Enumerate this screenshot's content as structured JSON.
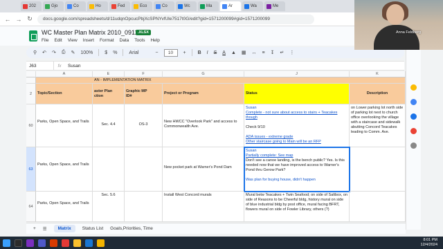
{
  "browser": {
    "tabs": [
      "202",
      "Gjo",
      "Co",
      "Ho",
      "Fed",
      "Eco",
      "Co",
      "Wc",
      "Ma",
      "Ar",
      "Wa",
      "Me"
    ],
    "url": "docs.google.com/spreadsheets/d/11udqnOpcucPbjXcSPNYvfUle7517t0G/edit?gid=1571200099#gid=1571200099"
  },
  "webcam": {
    "name": "Anna Feldberg"
  },
  "doc": {
    "title": "WC Master Plan Matrix 2010_091124",
    "badge": ".XLSX",
    "menus": [
      "File",
      "Edit",
      "View",
      "Insert",
      "Format",
      "Data",
      "Tools",
      "Help"
    ]
  },
  "toolbar": {
    "zoom": "100%",
    "font": "Arial",
    "font_size": "10"
  },
  "formula_bar": {
    "cell_ref": "J63",
    "fx": "fx",
    "value": "Susan"
  },
  "grid": {
    "columns": [
      "A",
      "E",
      "F",
      "G",
      "H",
      "J",
      "K"
    ],
    "banner": "AN - IMPLEMENTATION MATRIX",
    "header_row_num": "2",
    "headers": {
      "topic": "Topic/Section",
      "master_plan": "aster Plan\nction",
      "graphic": "Graphic MP\nID#",
      "project": "Project or Program",
      "status": "Status",
      "description": "Description"
    },
    "rows": [
      {
        "num": "60",
        "topic": "Parks, Open Space, and Trails",
        "section": "Sec. 4.4",
        "graphic": "OS-3",
        "project": "New HWCC \"Overlook Park\" and access to Commonwealth Ave.",
        "status_lines": [
          {
            "text": "Susan",
            "style": "blue"
          },
          {
            "text": "Complete - not sure about access to stairs + Teacakes though",
            "style": "link"
          },
          {
            "text": "",
            "style": ""
          },
          {
            "text": "Check 9/10",
            "style": ""
          },
          {
            "text": "",
            "style": ""
          },
          {
            "text": "ADA issues - extreme grade",
            "style": "link"
          },
          {
            "text": "Other staircase going to Main will be an RFP",
            "style": "link"
          }
        ],
        "description": "on Lower parking lot north side of parking lot next to church office overlooking the village with a staircase and sidewalk abutting Concord Teacakes leading to Comm. Ave."
      },
      {
        "num": "63",
        "topic": "Parks, Open Space, and Trails",
        "section": "",
        "graphic": "",
        "project": "New pocket park at Warner's Pond Dam",
        "status_lines": [
          {
            "text": "Susan",
            "style": "blue"
          },
          {
            "text": "Partially complete: See map",
            "style": "link"
          },
          {
            "text": "Don't see a canoe landing, is the bench public? Yes. Is this needed now that we have improved access to Warner's Pond thru Gerow Park?",
            "style": ""
          },
          {
            "text": "",
            "style": ""
          },
          {
            "text": "Was plan for buying house, didn't happen",
            "style": "blue"
          }
        ],
        "description": ""
      },
      {
        "num": "64",
        "topic": "Parks, Open Space, and Trails",
        "section": "Sec. 5.6",
        "graphic": "",
        "project": "Install West Concord murals",
        "status_lines": [
          {
            "text": "Mural betw Teacakes + Twin Seafood; on side of Saltbox, on side of Reasons to be Cheerful bldg, history mural on side of blue industrial bldg by post office, mural facing BFRT, flowers mural on side of Fowler Library, others (?)",
            "style": ""
          }
        ],
        "description": ""
      }
    ]
  },
  "sheet_tabs": [
    "Matrix",
    "Status List",
    "Goals,Priorities, Time"
  ],
  "tray": {
    "time": "8:01 PM",
    "date": "12/4/2024"
  }
}
